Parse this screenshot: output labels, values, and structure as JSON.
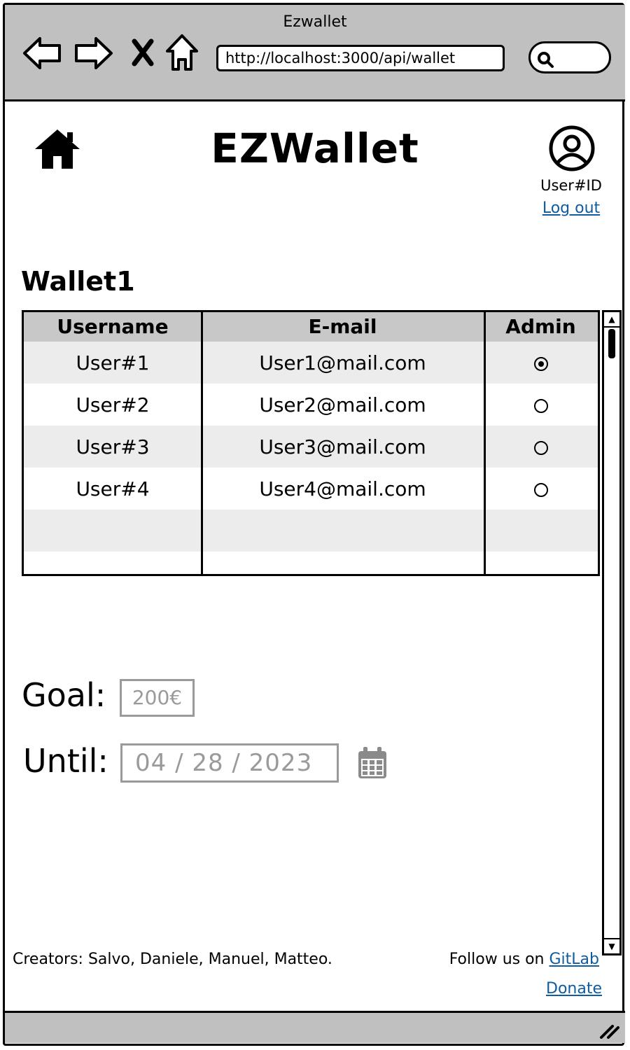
{
  "browser": {
    "window_title": "Ezwallet",
    "url": "http://localhost:3000/api/wallet",
    "icons": [
      "back-icon",
      "forward-icon",
      "stop-icon",
      "home-icon",
      "search-icon"
    ]
  },
  "header": {
    "app_title": "EZWallet",
    "user_id": "User#ID",
    "logout_label": "Log out"
  },
  "wallet": {
    "title": "Wallet1",
    "columns": [
      "Username",
      "E-mail",
      "Admin"
    ],
    "rows": [
      {
        "username": "User#1",
        "email": "User1@mail.com",
        "admin": true
      },
      {
        "username": "User#2",
        "email": "User2@mail.com",
        "admin": false
      },
      {
        "username": "User#3",
        "email": "User3@mail.com",
        "admin": false
      },
      {
        "username": "User#4",
        "email": "User4@mail.com",
        "admin": false
      }
    ]
  },
  "form": {
    "goal_label": "Goal:",
    "goal_placeholder": "200€",
    "until_label": "Until:",
    "until_placeholder": "04 / 28 / 2023"
  },
  "footer": {
    "creators": "Creators: Salvo, Daniele, Manuel, Matteo.",
    "follow_text": "Follow us on",
    "gitlab_label": "GitLab",
    "donate_label": "Donate"
  },
  "colors": {
    "chrome": "#c0c0c0",
    "link": "#0f5ca0",
    "header_row": "#c8c8c8",
    "stripe": "#ececec",
    "placeholder": "#9a9a9a"
  }
}
